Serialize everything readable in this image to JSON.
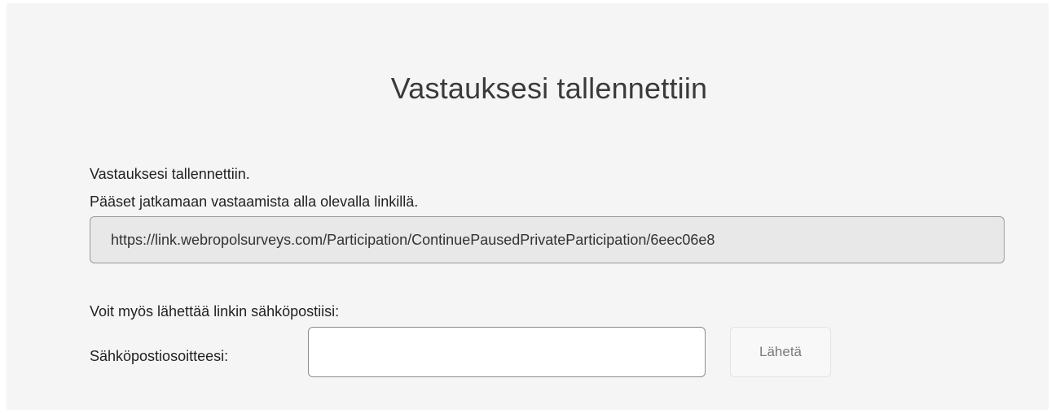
{
  "page": {
    "title": "Vastauksesi tallennettiin"
  },
  "message": {
    "line1": "Vastauksesi tallennettiin.",
    "line2": "Pääset jatkamaan vastaamista alla olevalla linkillä."
  },
  "continue_link": {
    "value": "https://link.webropolsurveys.com/Participation/ContinuePausedPrivateParticipation/6eec06e8"
  },
  "email": {
    "prompt": "Voit myös lähettää linkin sähköpostiisi:",
    "label": "Sähköpostiosoitteesi:",
    "value": "",
    "send_label": "Lähetä"
  },
  "colors": {
    "panel_background": "#f5f5f5",
    "link_box_background": "#e8e8e8",
    "button_text": "#7a7a7a"
  }
}
